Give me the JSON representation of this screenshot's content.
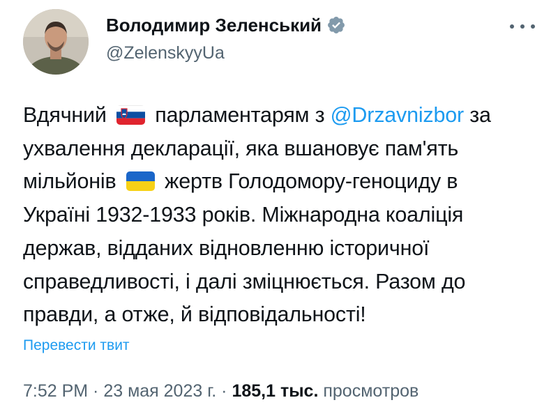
{
  "author": {
    "name": "Володимир Зеленський",
    "handle": "@ZelenskyyUa",
    "verified_color": "#829aab"
  },
  "tweet": {
    "line1_a": "Вдячний",
    "line1_flag": "slovenia-flag",
    "line1_b": "парламентарям з",
    "line1_mention": "@Drzavnizbor",
    "line1_c": "за",
    "line2": "ухвалення декларації, яка вшановує пам'ять",
    "line3_a": "мільйонів",
    "line3_flag": "ukraine-flag",
    "line3_b": "жертв Голодомору-геноциду в",
    "line4": "Україні 1932-1933 років. Міжнародна коаліція",
    "line5": "держав, відданих відновленню історичної",
    "line6": "справедливості, і далі зміцнюється. Разом до",
    "line7": "правди, а отже, й відповідальності!"
  },
  "translate_label": "Перевести твит",
  "meta": {
    "time": "7:52 PM",
    "sep1": " · ",
    "date": "23 мая 2023 г.",
    "sep2": " · ",
    "views_count": "185,1 тыс.",
    "views_label": "просмотров"
  },
  "colors": {
    "link": "#1d9bf0",
    "secondary_text": "#536471",
    "primary_text": "#0f1419"
  }
}
